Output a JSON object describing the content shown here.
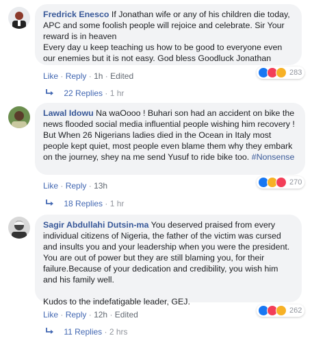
{
  "comments": [
    {
      "author": "Fredrick Enesco",
      "text": "If Jonathan wife or any of his children die today, APC and some foolish people will rejoice and celebrate. Sir Your reward is in heaven\nEvery day u keep teaching us how to be good to everyone even our enemies but it is not easy. God bless Goodluck Jonathan",
      "tag": "",
      "extra": "",
      "like": "Like",
      "reply": "Reply",
      "time": "1h",
      "edited": "Edited",
      "reaction_count": "283",
      "reactions": [
        "like",
        "love",
        "haha"
      ],
      "replies_label": "22 Replies",
      "replies_time": "1 hr"
    },
    {
      "author": "Lawal Idowu",
      "text": "Na waOooo ! Buhari son had an accident on bike the news flooded social media influential people wishing him recovery ! But When 26 Nigerians ladies died in the Ocean in Italy most people kept quiet, most people even blame them why they embark on the journey, shey na me send Yusuf to ride bike too. ",
      "tag": "#Nonsense",
      "extra": "",
      "like": "Like",
      "reply": "Reply",
      "time": "13h",
      "edited": "",
      "reaction_count": "270",
      "reactions": [
        "like",
        "haha",
        "love"
      ],
      "replies_label": "18 Replies",
      "replies_time": "1 hr"
    },
    {
      "author": "Sagir Abdullahi Dutsin-ma",
      "text": "You deserved praised from every individual citizens of Nigeria, the father of the victim was cursed and insults you and your leadership when you were the president. You are out of power but they are still blaming you, for their failure.Because of your dedication and credibility, you wish him and his family well.",
      "tag": "",
      "extra": "Kudos to the indefatigable leader, GEJ.",
      "like": "Like",
      "reply": "Reply",
      "time": "12h",
      "edited": "Edited",
      "reaction_count": "262",
      "reactions": [
        "like",
        "love",
        "haha"
      ],
      "replies_label": "11 Replies",
      "replies_time": "2 hrs"
    }
  ],
  "separator": "·",
  "colors": {
    "author": "#385898",
    "link": "#4267b2",
    "bubble": "#f2f3f5",
    "meta": "#90949c",
    "like": "#1877f2",
    "love": "#f33e58",
    "haha": "#f7b125"
  }
}
